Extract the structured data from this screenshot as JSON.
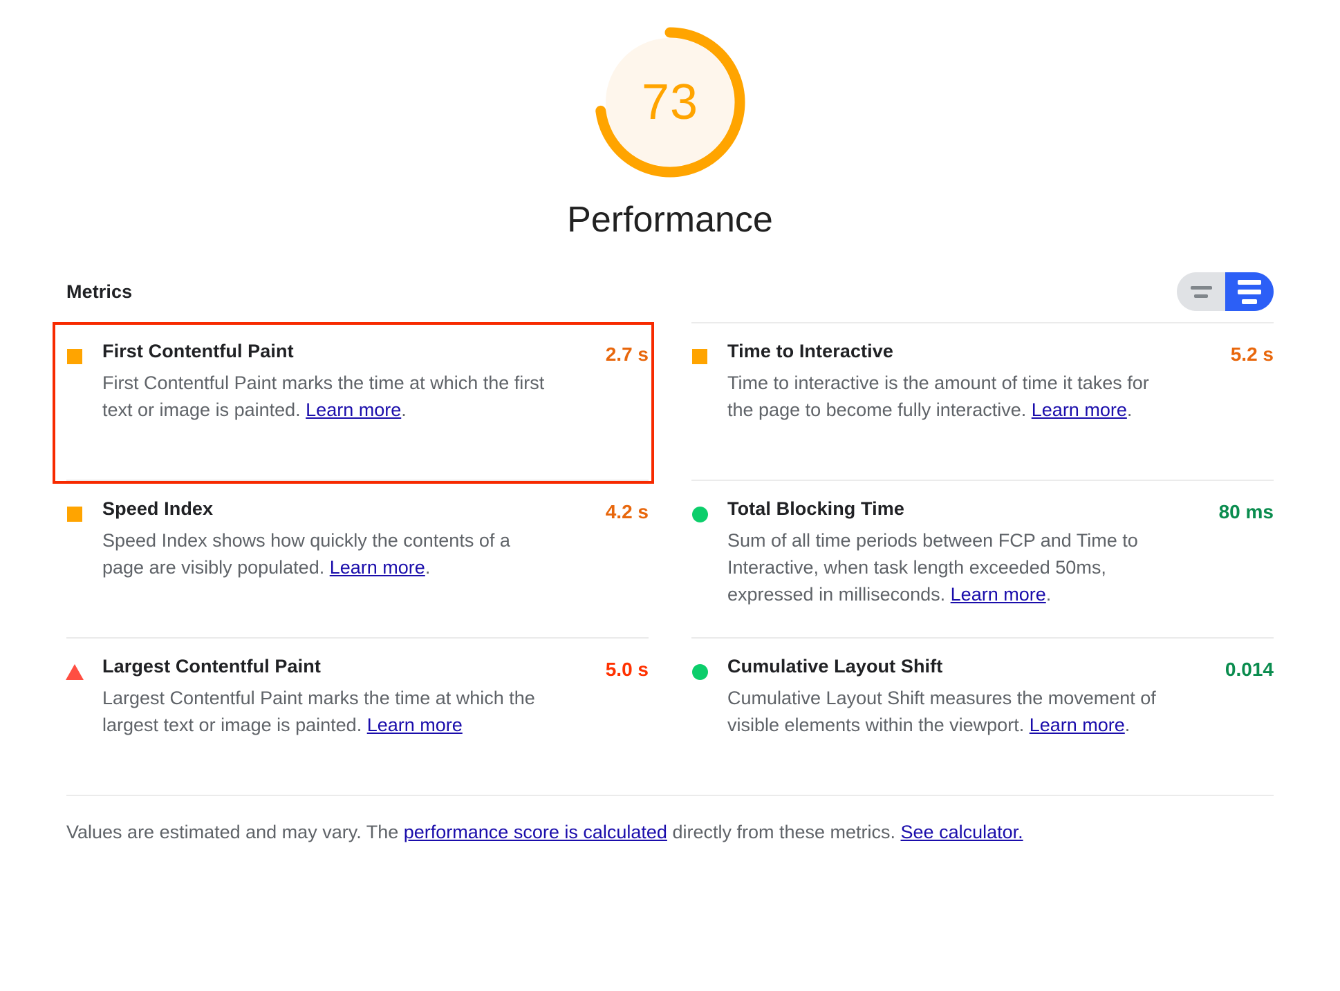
{
  "gauge": {
    "score": "73",
    "score_number": 73,
    "category_title": "Performance",
    "arc_color": "#ffa400",
    "fill_color": "#fef6ec",
    "percent_filled": 73
  },
  "metrics_header": {
    "title": "Metrics",
    "toggle": {
      "collapsed_icon": "short-lines-icon",
      "expanded_icon": "long-lines-icon",
      "selected": "expanded",
      "selected_color": "#2c5ff6",
      "unselected_color": "#e0e2e5"
    }
  },
  "metrics": [
    {
      "name": "First Contentful Paint",
      "value": "2.7 s",
      "value_class": "v-orange",
      "icon": "orange-square-icon",
      "icon_shape": "sq",
      "desc_before": "First Contentful Paint marks the time at which the first text or image is painted. ",
      "link_text": "Learn more",
      "desc_after": ".",
      "highlighted": true
    },
    {
      "name": "Time to Interactive",
      "value": "5.2 s",
      "value_class": "v-orange",
      "icon": "orange-square-icon",
      "icon_shape": "sq",
      "desc_before": "Time to interactive is the amount of time it takes for the page to become fully interactive. ",
      "link_text": "Learn more",
      "desc_after": ".",
      "highlighted": false
    },
    {
      "name": "Speed Index",
      "value": "4.2 s",
      "value_class": "v-orange",
      "icon": "orange-square-icon",
      "icon_shape": "sq",
      "desc_before": "Speed Index shows how quickly the contents of a page are visibly populated. ",
      "link_text": "Learn more",
      "desc_after": ".",
      "highlighted": false
    },
    {
      "name": "Total Blocking Time",
      "value": "80 ms",
      "value_class": "v-green",
      "icon": "green-circle-icon",
      "icon_shape": "dot",
      "desc_before": "Sum of all time periods between FCP and Time to Interactive, when task length exceeded 50ms, expressed in milliseconds. ",
      "link_text": "Learn more",
      "desc_after": ".",
      "highlighted": false
    },
    {
      "name": "Largest Contentful Paint",
      "value": "5.0 s",
      "value_class": "v-red",
      "icon": "red-triangle-icon",
      "icon_shape": "tri",
      "desc_before": "Largest Contentful Paint marks the time at which the largest text or image is painted. ",
      "link_text": "Learn more",
      "desc_after": "",
      "highlighted": false
    },
    {
      "name": "Cumulative Layout Shift",
      "value": "0.014",
      "value_class": "v-green",
      "icon": "green-circle-icon",
      "icon_shape": "dot",
      "desc_before": "Cumulative Layout Shift measures the movement of visible elements within the viewport. ",
      "link_text": "Learn more",
      "desc_after": ".",
      "highlighted": false
    }
  ],
  "footer": {
    "text_1": "Values are estimated and may vary. The ",
    "link_1": "performance score is calculated",
    "text_2": " directly from these metrics. ",
    "link_2": "See calculator."
  }
}
